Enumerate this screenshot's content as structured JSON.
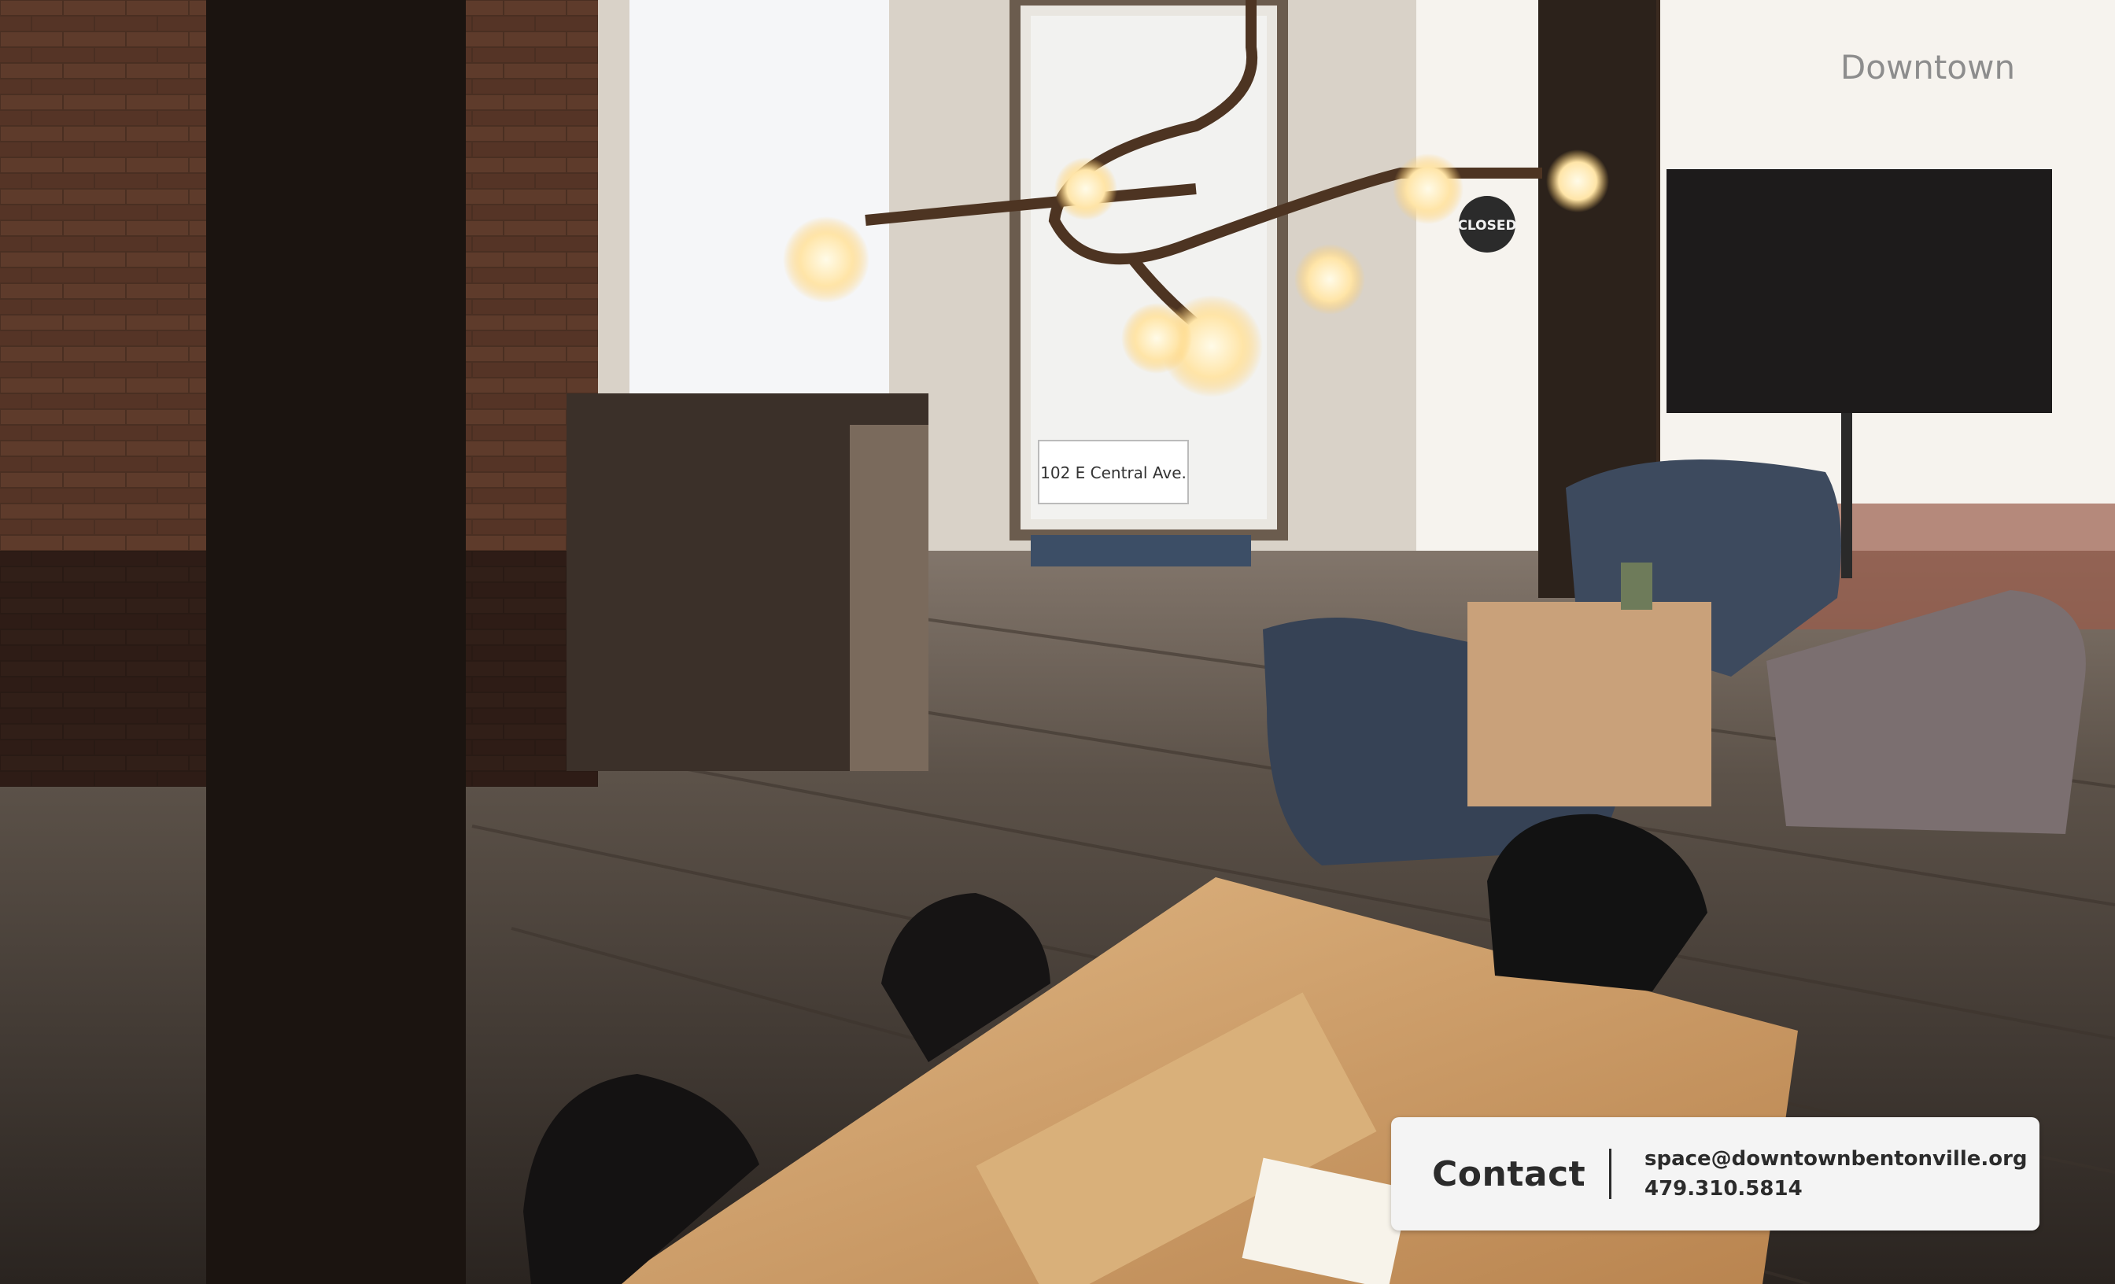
{
  "photo": {
    "door_sign": "102 E Central Ave.",
    "window_sign": "CLOSED",
    "window_lettering": "Downtown"
  },
  "contact": {
    "title": "Contact",
    "email": "space@downtownbentonville.org",
    "phone": "479.310.5814"
  }
}
